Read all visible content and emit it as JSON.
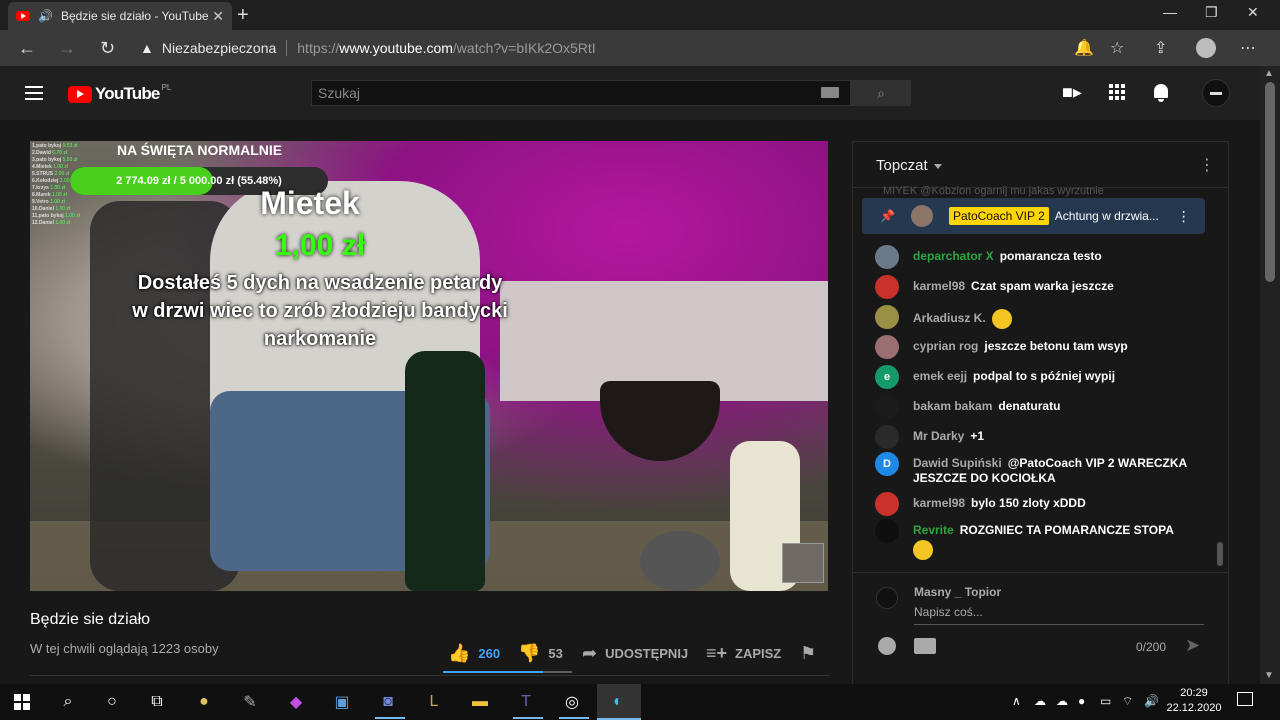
{
  "browser": {
    "tab_title": "Będzie sie działo - YouTube",
    "insecure_label": "Niezabezpieczona",
    "url_prefix": "https://",
    "url_host": "www.youtube.com",
    "url_path": "/watch?v=bIKk2Ox5RtI"
  },
  "youtube": {
    "logo_text": "YouTube",
    "region": "PL",
    "search_placeholder": "Szukaj"
  },
  "overlay": {
    "leaderboard": [
      {
        "name": "1.pato bykoj",
        "amount": "9.53 zł"
      },
      {
        "name": "2.Dawid",
        "amount": "6.78 zł"
      },
      {
        "name": "3.pato bykoj",
        "amount": "5.53 zł"
      },
      {
        "name": "4.Mietek",
        "amount": "1.00 zł"
      },
      {
        "name": "5.STRUS",
        "amount": "2.00 zł"
      },
      {
        "name": "6.Kołodziej",
        "amount": "2.00 zł"
      },
      {
        "name": "7.krzys",
        "amount": "1.00 zł"
      },
      {
        "name": "8.Marek",
        "amount": "1.00 zł"
      },
      {
        "name": "9.Vetro",
        "amount": "1.00 zł"
      },
      {
        "name": "10.Daniel",
        "amount": "1.00 zł"
      },
      {
        "name": "11.pato bykoj",
        "amount": "1.00 zł"
      },
      {
        "name": "12.Daniel",
        "amount": "1.00 zł"
      }
    ],
    "goal_title": "NA ŚWIĘTA NORMALNIE",
    "goal_progress_text": "2 774.09 zł / 5 000.00 zł (55.48%)",
    "goal_progress_fraction": 0.5548,
    "donor_name": "Mietek",
    "donation_amount": "1,00 zł",
    "donation_message": "Dostałeś 5 dych na wsadzenie petardy w drzwi wiec to zrób złodzieju bandycki narkomanie"
  },
  "video": {
    "title": "Będzie sie działo",
    "viewers": "W tej chwili oglądają 1223 osoby",
    "likes": "260",
    "dislikes": "53",
    "share_label": "UDOSTĘPNIJ",
    "save_label": "ZAPISZ"
  },
  "chat": {
    "mode": "Topczat",
    "faded_top": "MIYEK @Kobzion ogarnij mu jakas wyrzutnie",
    "pinned": {
      "badge": "PatoCoach VIP 2",
      "text": "Achtung w drzwia..."
    },
    "messages": [
      {
        "name": "deparchator X",
        "text": "pomarancza testo",
        "green": true,
        "color": "#6b7a8a"
      },
      {
        "name": "karmel98",
        "text": "Czat spam warka jeszcze",
        "green": false,
        "color": "#c8322b"
      },
      {
        "name": "Arkadiusz K.",
        "text": "",
        "green": false,
        "color": "#9b8f45",
        "emoji": true
      },
      {
        "name": "cyprian rog",
        "text": "jeszcze betonu tam wsyp",
        "green": false,
        "color": "#9a6f72"
      },
      {
        "name": "emek eejj",
        "text": "podpal to s później wypij",
        "green": false,
        "color": "#159a6c",
        "initial": "e"
      },
      {
        "name": "bakam bakam",
        "text": "denaturatu",
        "green": false,
        "color": "#1b1b1b"
      },
      {
        "name": "Mr Darky",
        "text": "+1",
        "green": false,
        "color": "#2a2a2a"
      },
      {
        "name": "Dawid Supiński",
        "text": "@PatoCoach VIP 2 WARECZKA JESZCZE DO KOCIOŁKA",
        "green": false,
        "color": "#1e88e5",
        "initial": "D"
      },
      {
        "name": "karmel98",
        "text": "bylo 150 zloty xDDD",
        "green": false,
        "color": "#c8322b"
      },
      {
        "name": "Revrite",
        "text": "ROZGNIEC TA POMARANCZE STOPA",
        "green": true,
        "color": "#0f0f0f",
        "emoji": true
      }
    ],
    "compose_user": "Masny _ Topior",
    "compose_placeholder": "Napisz coś...",
    "char_count": "0/200"
  },
  "taskbar": {
    "time": "20:29",
    "date": "22.12.2020"
  }
}
